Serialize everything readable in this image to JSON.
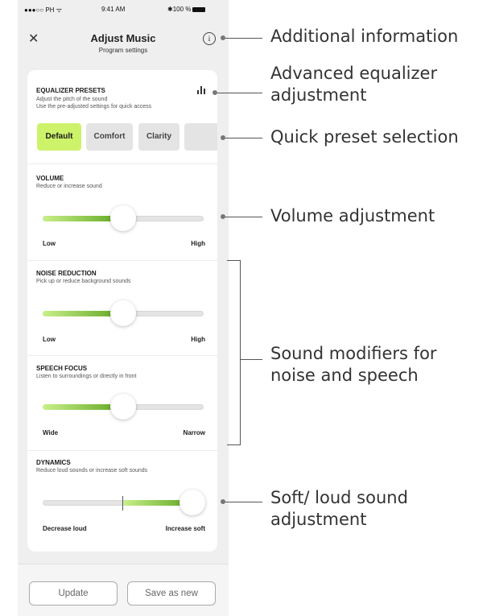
{
  "status_bar": {
    "carrier": "●●●○○ PH ᯤ",
    "time": "9:41 AM",
    "battery": "✱100 %"
  },
  "header": {
    "title": "Adjust Music",
    "subtitle": "Program settings",
    "close_icon": "close-icon",
    "info_icon": "info-icon"
  },
  "equalizer": {
    "heading": "EQUALIZER PRESETS",
    "desc1": "Adjust the pitch of the sound",
    "desc2": "Use the pre-adjusted settings for quick access",
    "presets": [
      {
        "label": "Default",
        "selected": true
      },
      {
        "label": "Comfort",
        "selected": false
      },
      {
        "label": "Clarity",
        "selected": false
      },
      {
        "label": "",
        "selected": false
      }
    ],
    "selected_color": "#cdf36b"
  },
  "volume": {
    "heading": "VOLUME",
    "desc": "Reduce or increase sound",
    "value": 0.5,
    "low": "Low",
    "high": "High"
  },
  "noise_reduction": {
    "heading": "NOISE REDUCTION",
    "desc": "Pick up or reduce background sounds",
    "value": 0.5,
    "low": "Low",
    "high": "High"
  },
  "speech_focus": {
    "heading": "SPEECH FOCUS",
    "desc": "Listen to surroundings or directly in front",
    "value": 0.5,
    "low": "Wide",
    "high": "Narrow"
  },
  "dynamics": {
    "heading": "DYNAMICS",
    "desc": "Reduce loud sounds or increase soft sounds",
    "value": 0.98,
    "reference": 0.5,
    "low": "Decrease loud",
    "high": "Increase soft"
  },
  "footer": {
    "update": "Update",
    "save_as_new": "Save as new"
  },
  "annotations": {
    "additional_info": "Additional information",
    "advanced_eq_1": "Advanced equalizer",
    "advanced_eq_2": "adjustment",
    "quick_preset": "Quick preset selection",
    "volume": "Volume adjustment",
    "sound_mod_1": "Sound modifiers for",
    "sound_mod_2": "noise and speech",
    "soft_loud_1": "Soft/ loud sound",
    "soft_loud_2": "adjustment"
  }
}
